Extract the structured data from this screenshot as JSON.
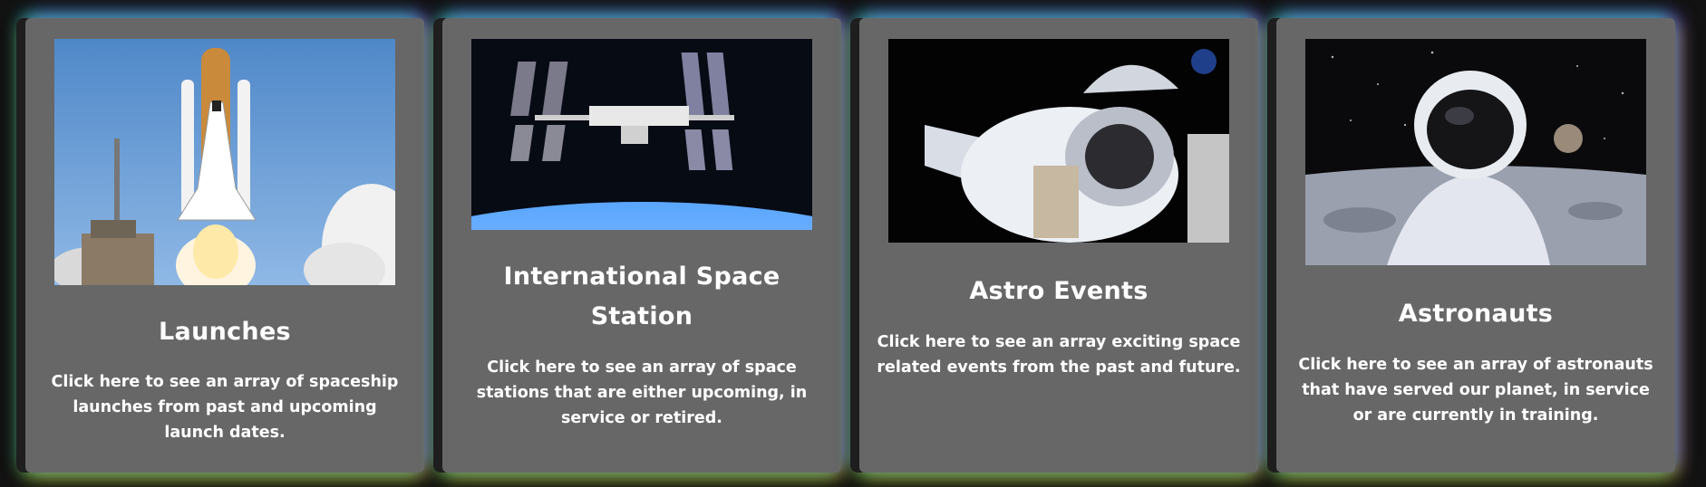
{
  "cards": [
    {
      "title": "Launches",
      "description": "Click here to see an array of spaceship launches from past and upcoming launch dates.",
      "image_icon": "space-shuttle-launch-image"
    },
    {
      "title": "International Space Station",
      "description": "Click here to see an array of space stations that are either upcoming, in service or retired.",
      "image_icon": "iss-image"
    },
    {
      "title": "Astro Events",
      "description": "Click here to see an array exciting space related events from the past and future.",
      "image_icon": "capsule-docking-image"
    },
    {
      "title": "Astronauts",
      "description": "Click here to see an array of astronauts that have served our planet, in service or are currently in training.",
      "image_icon": "astronaut-moon-image"
    }
  ],
  "colors": {
    "background": "#121212",
    "card": "#676767",
    "text": "#ffffff",
    "glow_cyan": "#28d2e6",
    "glow_purple": "#7850f0",
    "glow_green": "#96dc3c"
  }
}
